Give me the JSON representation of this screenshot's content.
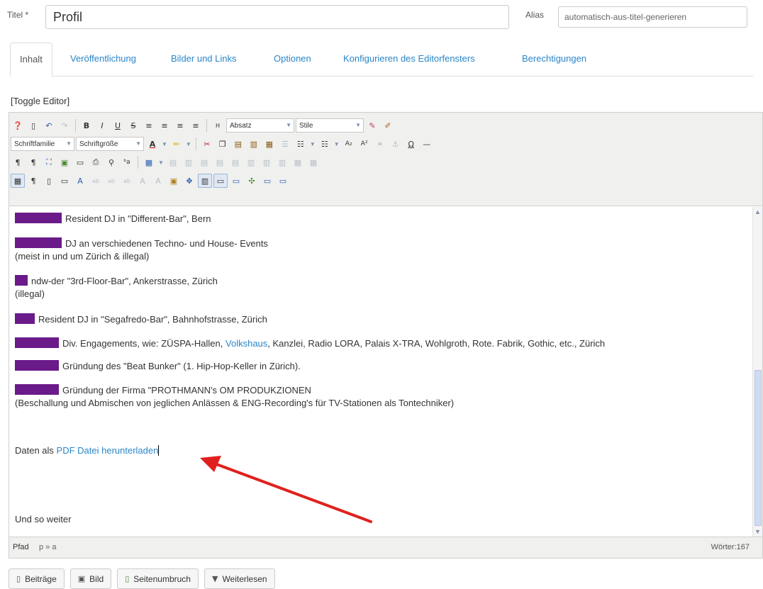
{
  "form": {
    "title_label": "Titel *",
    "title_value": "Profil",
    "alias_label": "Alias",
    "alias_value": "automatisch-aus-titel-generieren"
  },
  "tabs": [
    {
      "label": "Inhalt"
    },
    {
      "label": "Veröffentlichung"
    },
    {
      "label": "Bilder und Links"
    },
    {
      "label": "Optionen"
    },
    {
      "label": "Konfigurieren des Editorfensters"
    },
    {
      "label": "Berechtigungen"
    }
  ],
  "toggle_editor": "[Toggle Editor]",
  "toolbar": {
    "format_select": "Absatz",
    "style_select": "Stile",
    "font_family_select": "Schriftfamilie",
    "font_size_select": "Schriftgröße"
  },
  "content": {
    "p1": "Resident DJ in \"Different-Bar\", Bern",
    "p2a": "DJ an verschiedenen Techno- und House- Events",
    "p2b": "(meist in und um Zürich & illegal)",
    "p3a": "ndw-der \"3rd-Floor-Bar\", Ankerstrasse, Zürich",
    "p3b": "(illegal)",
    "p4": "Resident DJ in \"Segafredo-Bar\", Bahnhofstrasse, Zürich",
    "p5_pre": "Div. Engagements, wie: ZÜSPA-Hallen,",
    "p5_link": "Volkshaus",
    "p5_post": ", Kanzlei, Radio LORA, Palais X-TRA, Wohlgroth, Rote. Fabrik, Gothic, etc., Zürich",
    "p6": "Gründung des \"Beat Bunker\" (1. Hip-Hop-Keller in Zürich).",
    "p7a": "Gründung der Firma \"PROTHMANN's OM PRODUKZIONEN",
    "p7b": "(Beschallung und Abmischen von jeglichen Anlässen & ENG-Recording's für TV-Stationen als Tontechniker)",
    "pdf_pre": "Daten als",
    "pdf_link": "PDF Datei herunterladen",
    "last": "Und so weiter"
  },
  "status": {
    "path_label": "Pfad",
    "path_value": "p » a",
    "word_count": "Wörter:167"
  },
  "buttons": {
    "articles": "Beiträge",
    "image": "Bild",
    "pagebreak": "Seitenumbruch",
    "readmore": "Weiterlesen"
  },
  "colors": {
    "highlight": "#6b1a8a",
    "link": "#2a86c9",
    "annotation_arrow": "#e0201e"
  }
}
